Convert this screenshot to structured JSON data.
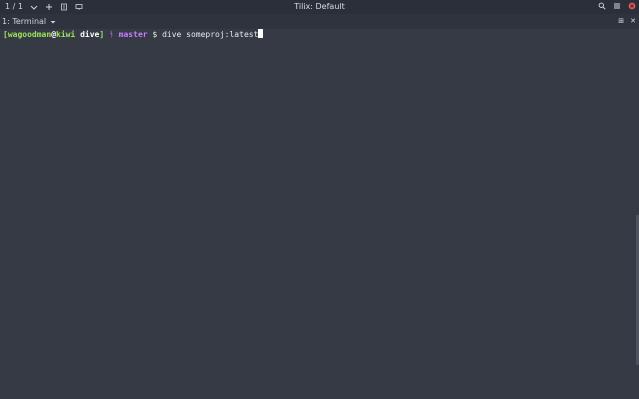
{
  "titlebar": {
    "tab_counter": "1 / 1",
    "counter_dropdown_icon": "chevron-down-icon",
    "add_icon": "add-icon",
    "new_window_icon": "new-window-icon",
    "pane_icon": "pane-icon",
    "title": "Tilix: Default",
    "search_icon": "search-icon",
    "menu_icon": "menu-icon",
    "close_icon": "close-icon"
  },
  "tab": {
    "label": "1: Terminal",
    "dropdown_icon": "chevron-down-icon",
    "action_a": "⊞",
    "action_b": "✕"
  },
  "terminal": {
    "prompt_open": "[",
    "user": "wagoodman",
    "at": "@",
    "host": "kiwi",
    "dir": "dive",
    "prompt_close": "]",
    "branch_icon": "ᚬ",
    "branch": "master",
    "dollar": "$",
    "command": "dive someproj:latest"
  },
  "colors": {
    "bg": "#353a45",
    "titlebar": "#2b2f38",
    "tabbar": "#2f333d",
    "user": "#9fe35a",
    "host": "#ff7a7a",
    "dir": "#ffffff",
    "branch": "#c77dff",
    "text": "#e6e9ee",
    "close": "#e25555"
  }
}
